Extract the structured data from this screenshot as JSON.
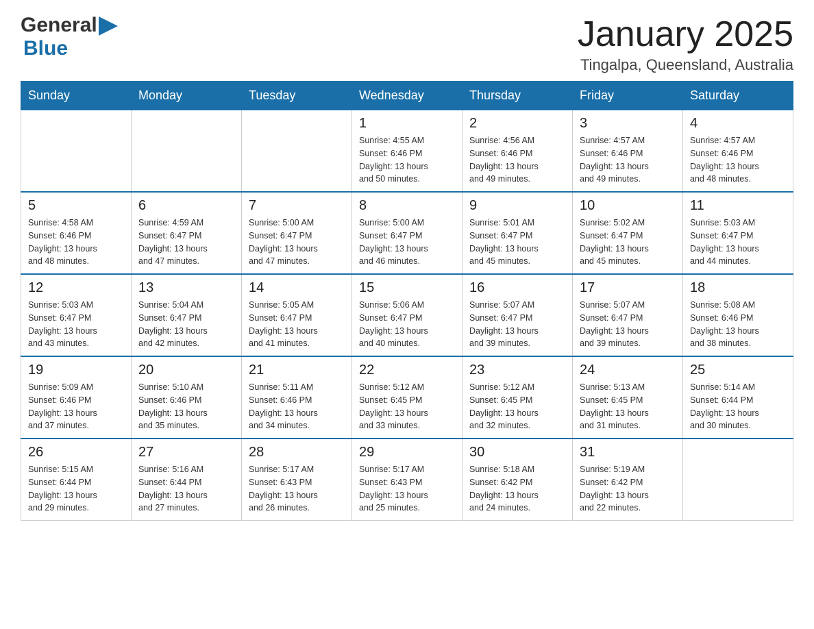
{
  "header": {
    "logo_general": "General",
    "logo_blue": "Blue",
    "month_title": "January 2025",
    "location": "Tingalpa, Queensland, Australia"
  },
  "days_of_week": [
    "Sunday",
    "Monday",
    "Tuesday",
    "Wednesday",
    "Thursday",
    "Friday",
    "Saturday"
  ],
  "weeks": [
    [
      {
        "day": "",
        "info": ""
      },
      {
        "day": "",
        "info": ""
      },
      {
        "day": "",
        "info": ""
      },
      {
        "day": "1",
        "info": "Sunrise: 4:55 AM\nSunset: 6:46 PM\nDaylight: 13 hours\nand 50 minutes."
      },
      {
        "day": "2",
        "info": "Sunrise: 4:56 AM\nSunset: 6:46 PM\nDaylight: 13 hours\nand 49 minutes."
      },
      {
        "day": "3",
        "info": "Sunrise: 4:57 AM\nSunset: 6:46 PM\nDaylight: 13 hours\nand 49 minutes."
      },
      {
        "day": "4",
        "info": "Sunrise: 4:57 AM\nSunset: 6:46 PM\nDaylight: 13 hours\nand 48 minutes."
      }
    ],
    [
      {
        "day": "5",
        "info": "Sunrise: 4:58 AM\nSunset: 6:46 PM\nDaylight: 13 hours\nand 48 minutes."
      },
      {
        "day": "6",
        "info": "Sunrise: 4:59 AM\nSunset: 6:47 PM\nDaylight: 13 hours\nand 47 minutes."
      },
      {
        "day": "7",
        "info": "Sunrise: 5:00 AM\nSunset: 6:47 PM\nDaylight: 13 hours\nand 47 minutes."
      },
      {
        "day": "8",
        "info": "Sunrise: 5:00 AM\nSunset: 6:47 PM\nDaylight: 13 hours\nand 46 minutes."
      },
      {
        "day": "9",
        "info": "Sunrise: 5:01 AM\nSunset: 6:47 PM\nDaylight: 13 hours\nand 45 minutes."
      },
      {
        "day": "10",
        "info": "Sunrise: 5:02 AM\nSunset: 6:47 PM\nDaylight: 13 hours\nand 45 minutes."
      },
      {
        "day": "11",
        "info": "Sunrise: 5:03 AM\nSunset: 6:47 PM\nDaylight: 13 hours\nand 44 minutes."
      }
    ],
    [
      {
        "day": "12",
        "info": "Sunrise: 5:03 AM\nSunset: 6:47 PM\nDaylight: 13 hours\nand 43 minutes."
      },
      {
        "day": "13",
        "info": "Sunrise: 5:04 AM\nSunset: 6:47 PM\nDaylight: 13 hours\nand 42 minutes."
      },
      {
        "day": "14",
        "info": "Sunrise: 5:05 AM\nSunset: 6:47 PM\nDaylight: 13 hours\nand 41 minutes."
      },
      {
        "day": "15",
        "info": "Sunrise: 5:06 AM\nSunset: 6:47 PM\nDaylight: 13 hours\nand 40 minutes."
      },
      {
        "day": "16",
        "info": "Sunrise: 5:07 AM\nSunset: 6:47 PM\nDaylight: 13 hours\nand 39 minutes."
      },
      {
        "day": "17",
        "info": "Sunrise: 5:07 AM\nSunset: 6:47 PM\nDaylight: 13 hours\nand 39 minutes."
      },
      {
        "day": "18",
        "info": "Sunrise: 5:08 AM\nSunset: 6:46 PM\nDaylight: 13 hours\nand 38 minutes."
      }
    ],
    [
      {
        "day": "19",
        "info": "Sunrise: 5:09 AM\nSunset: 6:46 PM\nDaylight: 13 hours\nand 37 minutes."
      },
      {
        "day": "20",
        "info": "Sunrise: 5:10 AM\nSunset: 6:46 PM\nDaylight: 13 hours\nand 35 minutes."
      },
      {
        "day": "21",
        "info": "Sunrise: 5:11 AM\nSunset: 6:46 PM\nDaylight: 13 hours\nand 34 minutes."
      },
      {
        "day": "22",
        "info": "Sunrise: 5:12 AM\nSunset: 6:45 PM\nDaylight: 13 hours\nand 33 minutes."
      },
      {
        "day": "23",
        "info": "Sunrise: 5:12 AM\nSunset: 6:45 PM\nDaylight: 13 hours\nand 32 minutes."
      },
      {
        "day": "24",
        "info": "Sunrise: 5:13 AM\nSunset: 6:45 PM\nDaylight: 13 hours\nand 31 minutes."
      },
      {
        "day": "25",
        "info": "Sunrise: 5:14 AM\nSunset: 6:44 PM\nDaylight: 13 hours\nand 30 minutes."
      }
    ],
    [
      {
        "day": "26",
        "info": "Sunrise: 5:15 AM\nSunset: 6:44 PM\nDaylight: 13 hours\nand 29 minutes."
      },
      {
        "day": "27",
        "info": "Sunrise: 5:16 AM\nSunset: 6:44 PM\nDaylight: 13 hours\nand 27 minutes."
      },
      {
        "day": "28",
        "info": "Sunrise: 5:17 AM\nSunset: 6:43 PM\nDaylight: 13 hours\nand 26 minutes."
      },
      {
        "day": "29",
        "info": "Sunrise: 5:17 AM\nSunset: 6:43 PM\nDaylight: 13 hours\nand 25 minutes."
      },
      {
        "day": "30",
        "info": "Sunrise: 5:18 AM\nSunset: 6:42 PM\nDaylight: 13 hours\nand 24 minutes."
      },
      {
        "day": "31",
        "info": "Sunrise: 5:19 AM\nSunset: 6:42 PM\nDaylight: 13 hours\nand 22 minutes."
      },
      {
        "day": "",
        "info": ""
      }
    ]
  ]
}
